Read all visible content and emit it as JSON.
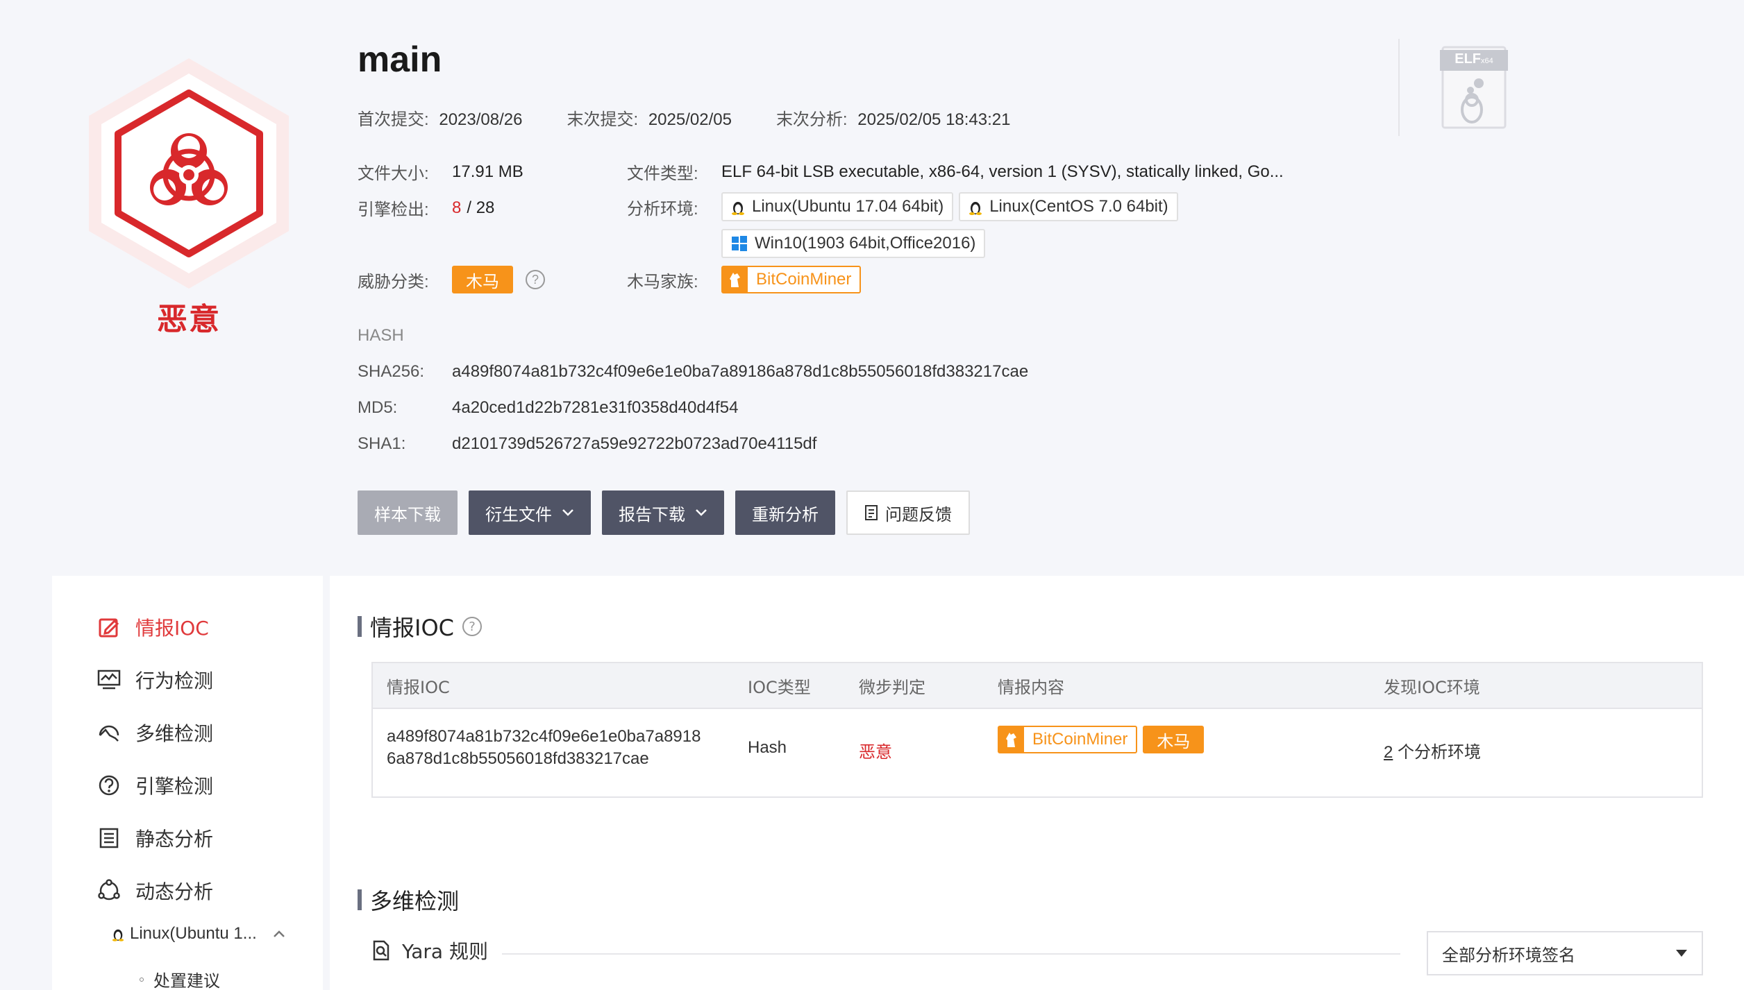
{
  "file": {
    "name": "main",
    "verdict": "恶意",
    "first_submit_label": "首次提交:",
    "first_submit": "2023/08/26",
    "last_submit_label": "末次提交:",
    "last_submit": "2025/02/05",
    "last_analysis_label": "末次分析:",
    "last_analysis": "2025/02/05 18:43:21",
    "size_label": "文件大小:",
    "size": "17.91 MB",
    "engine_label": "引擎检出:",
    "engine_hits": "8",
    "engine_total": "/ 28",
    "threat_label": "威胁分类:",
    "threat": "木马",
    "type_label": "文件类型:",
    "type": "ELF 64-bit LSB executable, x86-64, version 1 (SYSV), statically linked, Go...",
    "env_label": "分析环境:",
    "envs": [
      "Linux(Ubuntu 17.04 64bit)",
      "Linux(CentOS 7.0 64bit)",
      "Win10(1903 64bit,Office2016)"
    ],
    "family_label": "木马家族:",
    "family": "BitCoinMiner",
    "elf_badge": "ELF",
    "elf_arch": "x64"
  },
  "hash": {
    "title": "HASH",
    "sha256_label": "SHA256:",
    "sha256": "a489f8074a81b732c4f09e6e1e0ba7a89186a878d1c8b55056018fd383217cae",
    "md5_label": "MD5:",
    "md5": "4a20ced1d22b7281e31f0358d40d4f54",
    "sha1_label": "SHA1:",
    "sha1": "d2101739d526727a59e92722b0723ad70e4115df"
  },
  "actions": {
    "sample_download": "样本下载",
    "derived_files": "衍生文件",
    "report_download": "报告下载",
    "reanalyze": "重新分析",
    "feedback": "问题反馈"
  },
  "sidebar": {
    "items": [
      "情报IOC",
      "行为检测",
      "多维检测",
      "引擎检测",
      "静态分析",
      "动态分析"
    ],
    "sub_env": "Linux(Ubuntu 1...",
    "sub_item": "处置建议"
  },
  "ioc": {
    "title": "情报IOC",
    "columns": [
      "情报IOC",
      "IOC类型",
      "微步判定",
      "情报内容",
      "发现IOC环境"
    ],
    "row": {
      "ioc_line1": "a489f8074a81b732c4f09e6e1e0ba7a8918",
      "ioc_line2": "6a878d1c8b55056018fd383217cae",
      "type": "Hash",
      "verdict": "恶意",
      "family": "BitCoinMiner",
      "tag": "木马",
      "env_count": "2",
      "env_suffix": " 个分析环境"
    }
  },
  "multi": {
    "title": "多维检测",
    "yara_label": "Yara 规则",
    "select_value": "全部分析环境签名"
  },
  "colors": {
    "malicious": "#d8282b",
    "accent_orange": "#f7931a",
    "dark_button": "#505466"
  }
}
